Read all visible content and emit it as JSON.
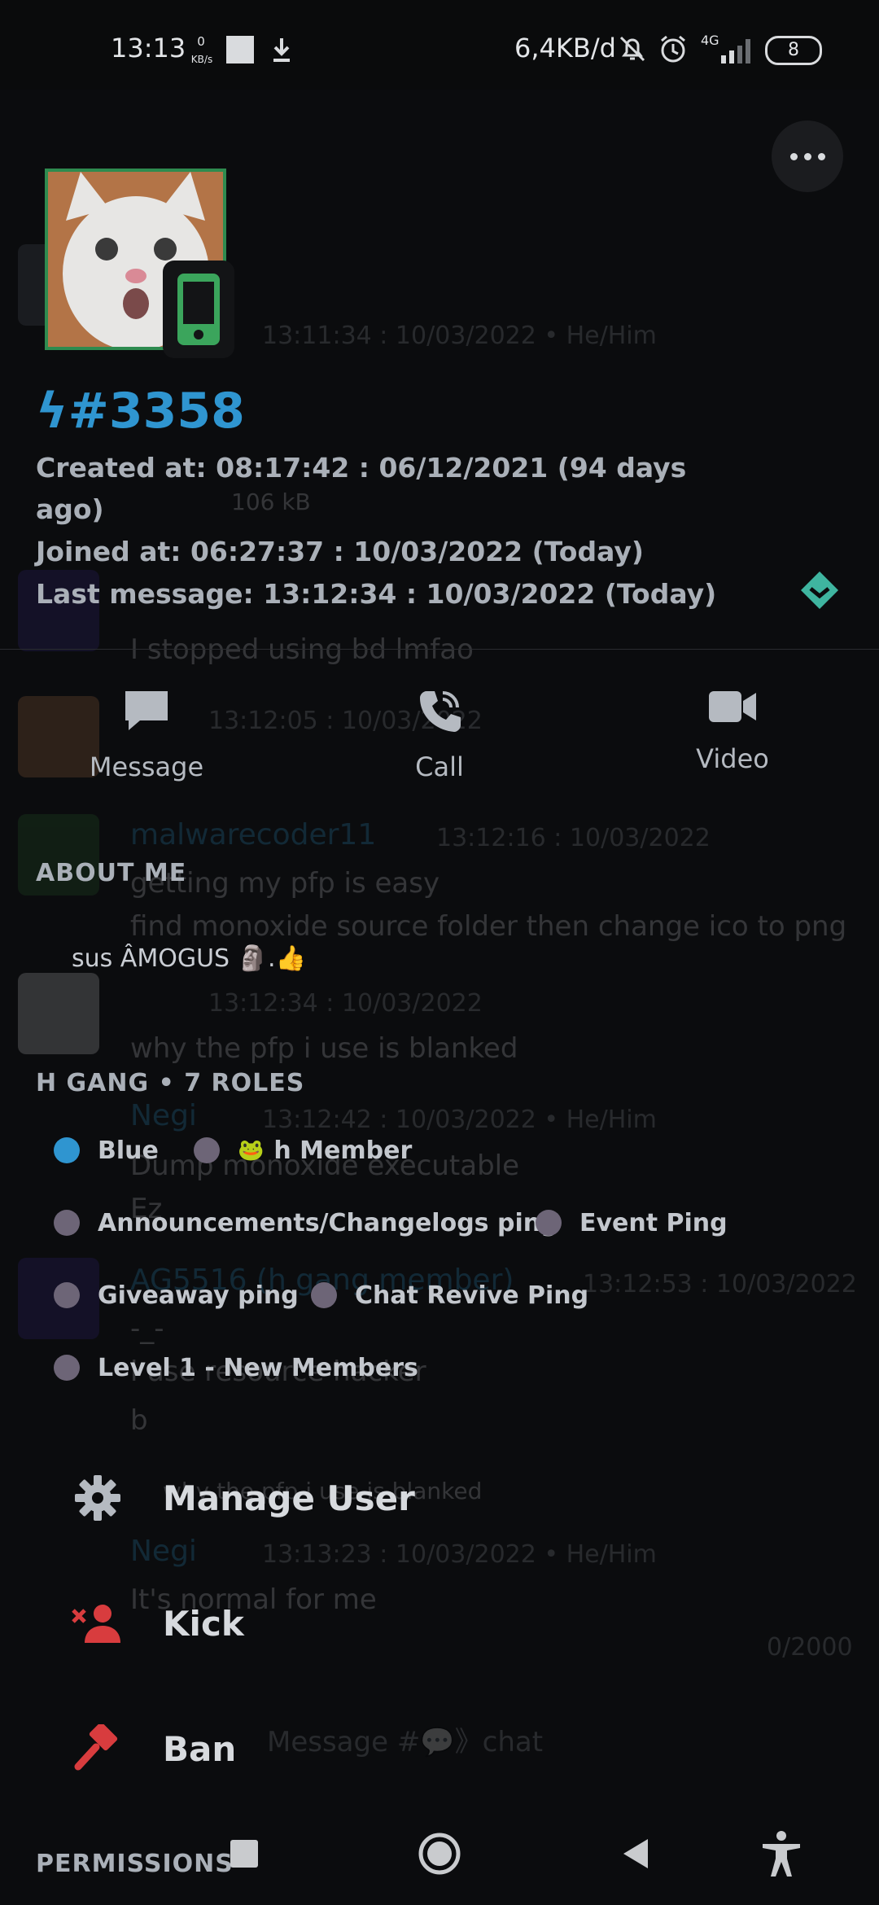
{
  "status_bar": {
    "time": "13:13",
    "net_speed_value": "0",
    "net_speed_unit": "KB/s",
    "data_usage": "6,4KB/d",
    "network_type": "4G",
    "battery": "8"
  },
  "background_chat": [
    {
      "name": "",
      "time": "13:11:34 : 10/03/2022 • He/Him"
    },
    {
      "file_size": "106 kB"
    },
    {
      "name": "",
      "time": "13:12:0 : 10/03/2022",
      "text": "I stopped using bd lmfao"
    },
    {
      "name": "",
      "time": "13:12:05 : 10/03/2022",
      "text": ""
    },
    {
      "name": "malwarecoder11",
      "time": "13:12:16 : 10/03/2022",
      "text": "getting my pfp is easy",
      "text2": "find monoxide source folder then change ico to png"
    },
    {
      "name": "",
      "time": "13:12:34 : 10/03/2022",
      "text": "why the pfp i use is blanked"
    },
    {
      "name": "Negi",
      "time": "13:12:42 : 10/03/2022 • He/Him",
      "text": "Dump monoxide executable",
      "text2": "Ez"
    },
    {
      "name": "AG5516 (h gang member)",
      "time": "13:12:53 : 10/03/2022",
      "text": "-_-",
      "text2": "i use resource hacker",
      "text3": "b"
    },
    {
      "text": "why the pfp i use is blanked"
    },
    {
      "name": "Negi",
      "time": "13:13:23 : 10/03/2022 • He/Him",
      "text": "It's normal for me"
    },
    {
      "char_count": "0/2000"
    },
    {
      "input_placeholder": "Message #💬》chat"
    }
  ],
  "profile": {
    "username": "ϟ#3358",
    "created_at": "Created at: 08:17:42 : 06/12/2021 (94 days",
    "created_at_cont": "ago)",
    "joined_at": "Joined at: 06:27:37 : 10/03/2022 (Today)",
    "last_message": "Last message: 13:12:34 : 10/03/2022 (Today)"
  },
  "actions": {
    "message": "Message",
    "call": "Call",
    "video": "Video"
  },
  "about_me": {
    "title": "ABOUT ME",
    "text": "sus ÂMOGUS 🗿.👍"
  },
  "roles": {
    "title": "H GANG • 7 ROLES",
    "items": [
      {
        "label": "Blue",
        "color": "#2f95d0"
      },
      {
        "label": "h Member",
        "color": "#6d6577",
        "emoji": "🐸"
      },
      {
        "label": "Announcements/Changelogs ping",
        "color": "#6d6577"
      },
      {
        "label": "Event Ping",
        "color": "#6d6577"
      },
      {
        "label": "Giveaway ping",
        "color": "#6d6577"
      },
      {
        "label": "Chat Revive Ping",
        "color": "#6d6577"
      },
      {
        "label": "Level 1 - New Members",
        "color": "#6d6577"
      }
    ]
  },
  "menu": {
    "manage_user": "Manage User",
    "kick": "Kick",
    "ban": "Ban"
  },
  "permissions": {
    "title": "PERMISSIONS"
  },
  "colors": {
    "accent_blue": "#2f95d0",
    "online_green": "#2e8b4f",
    "danger_red": "#d83c3e",
    "nitro_teal": "#3fb5a0"
  }
}
